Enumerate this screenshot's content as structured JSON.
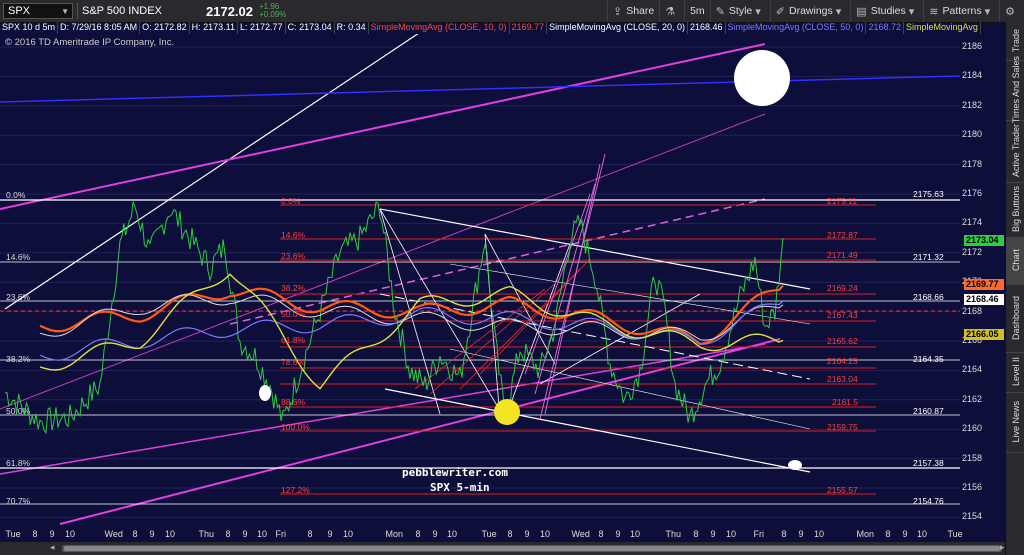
{
  "toolbar": {
    "symbol": "SPX",
    "index_name": "S&P 500 INDEX",
    "price": "2172.02",
    "change": "+1.96",
    "change_pct": "+0.09%",
    "share": "Share",
    "timeframe": "5m",
    "style": "Style",
    "drawings": "Drawings",
    "studies": "Studies",
    "patterns": "Patterns"
  },
  "info": {
    "label": "SPX 10 d 5m",
    "date": "D: 7/29/16 8:05 AM",
    "open": "O: 2172.82",
    "high": "H: 2173.11",
    "low": "L: 2172.77",
    "close": "C: 2173.04",
    "range": "R: 0.34",
    "sma10": "SimpleMovingAvg (CLOSE, 10, 0)",
    "sma10_val": "2169.77",
    "sma20": "SimpleMovingAvg (CLOSE, 20, 0)",
    "sma20_val": "2168.46",
    "sma50": "SimpleMovingAvg (CLOSE, 50, 0)",
    "sma50_val": "2168.72",
    "sma_more": "SimpleMovingAvg"
  },
  "copyright": "© 2016 TD Ameritrade IP Company, Inc.",
  "watermark": {
    "line1": "pebblewriter.com",
    "line2": "SPX 5-min"
  },
  "colors": {
    "background": "#0e0e3a",
    "grid": "#262660",
    "magenta": "#e040e0",
    "orange": "#ff5a14",
    "yellow": "#e0e040",
    "fib_red": "#e02020",
    "price_green": "#2ecc40",
    "sma10_label": "#ff6a2c",
    "sma20_label": "#ffffff",
    "sma50_label": "#d0c020"
  },
  "price_axis": {
    "ticks": [
      "2186",
      "2184",
      "2182",
      "2180",
      "2178",
      "2176",
      "2174",
      "2172",
      "2170",
      "2168",
      "2166",
      "2164",
      "2162",
      "2160",
      "2158",
      "2156",
      "2154"
    ],
    "labels": [
      {
        "text": "2173.04",
        "color": "#2ecc40"
      },
      {
        "text": "2169.77",
        "color": "#ff6a2c"
      },
      {
        "text": "2168.46",
        "color": "#ffffff"
      },
      {
        "text": "2166.05",
        "color": "#d0c020"
      }
    ]
  },
  "time_axis": [
    "Tue",
    "8",
    "9",
    "10",
    "Wed",
    "8",
    "9",
    "10",
    "Thu",
    "8",
    "9",
    "10",
    "Fri",
    "8",
    "9",
    "10",
    "Mon",
    "8",
    "9",
    "10",
    "Tue",
    "8",
    "9",
    "10",
    "Wed",
    "8",
    "9",
    "10",
    "Thu",
    "8",
    "9",
    "10",
    "Fri",
    "8",
    "9",
    "10",
    "Mon",
    "8",
    "9",
    "10",
    "Tue"
  ],
  "fib_left": [
    "0.0%",
    "14.6%",
    "23.6%",
    "38.2%",
    "50.0%",
    "61.8%",
    "70.7%"
  ],
  "fib_mid": [
    "0.0%",
    "14.6%",
    "23.6%",
    "38.2%",
    "50.0%",
    "61.8%",
    "78.6%",
    "88.6%",
    "100.0%",
    "127.2%"
  ],
  "fib_red_vals": [
    "2175.11",
    "2172.87",
    "2171.49",
    "2169.24",
    "2167.43",
    "2165.62",
    "2164.25",
    "2163.04",
    "2161.5",
    "2159.75",
    "2155.57"
  ],
  "level_vals": [
    "2175.63",
    "2171.32",
    "2168.66",
    "2164.35",
    "2160.87",
    "2157.38",
    "2154.76"
  ],
  "sidebar_tabs": [
    "Trade",
    "Times And Sales",
    "Active Trader",
    "Big Buttons",
    "Chart",
    "Dashboard",
    "Level II",
    "Live News"
  ],
  "chart_data": {
    "type": "line",
    "title": "SPX 10 d 5m",
    "x": [
      "Tue",
      "Wed",
      "Thu",
      "Fri",
      "Mon",
      "Tue",
      "Wed",
      "Thu",
      "Fri"
    ],
    "series": [
      {
        "name": "SimpleMovingAvg (CLOSE, 10, 0)",
        "values": [
          2167.0,
          2167.8,
          2169.5,
          2168.3,
          2168.0,
          2168.5,
          2167.5,
          2166.0,
          2169.77
        ]
      },
      {
        "name": "SimpleMovingAvg (CLOSE, 20, 0)",
        "values": [
          2166.5,
          2168.3,
          2169.0,
          2168.0,
          2167.5,
          2167.0,
          2166.8,
          2166.3,
          2168.46
        ]
      },
      {
        "name": "SimpleMovingAvg (CLOSE, 50, 0)",
        "values": [
          2165.0,
          2166.0,
          2166.8,
          2167.1,
          2167.8,
          2167.5,
          2167.0,
          2166.0,
          2168.72
        ]
      }
    ],
    "last_price": 2173.04,
    "ylim": [
      2153,
      2187
    ],
    "grid": true
  }
}
